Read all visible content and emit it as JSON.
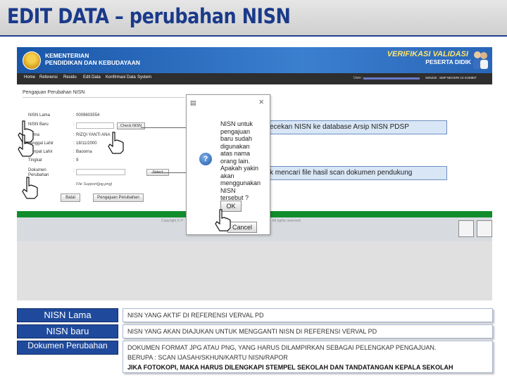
{
  "slide_title": "EDIT DATA – perubahan NISN",
  "app": {
    "ministry_line1": "KEMENTERIAN",
    "ministry_line2": "PENDIDIKAN DAN KEBUDAYAAN",
    "verif_title": "VERIFIKASI VALIDASI",
    "verif_subtitle": "PESERTA DIDIK",
    "nav": {
      "home": "Home",
      "referensi": "Referensi",
      "residu": "Residu",
      "edit_data": "Edit Data",
      "konfirmasi": "Konfirmasi Data",
      "system": "System"
    },
    "user_label": "User :",
    "school": "Sekolah : SMP NEGERI 10 SUMBIT",
    "form_title": "Pengajuan Perubahan NISN",
    "fields": {
      "nisn_lama_label": "NISN Lama",
      "nisn_lama_value": "0009603554",
      "nisn_baru_label": "NISN Baru",
      "check_nisn_btn": "Check NISN",
      "nama_label": "Nama",
      "nama_value": "RIZQI YANTI ANA",
      "tgl_lahir_label": "Tanggal Lahir",
      "tgl_lahir_value": "18/11/2000",
      "tempat_lahir_label": "Tempat Lahir",
      "tempat_lahir_value": "Baoorna",
      "tingkat_label": "Tingkat",
      "tingkat_value": "9",
      "dokumen_label_1": "Dokumen",
      "dokumen_label_2": "Perubahan",
      "select_btn": "Select",
      "file_hint": "File Support(jpg,png)"
    },
    "batal_btn": "Batal",
    "pengajuan_btn": "Pengajuan Perubahan",
    "copyright_left": "Copyright © P",
    "copyright_right": ". All rights reserved."
  },
  "callouts": {
    "check_nisn": "ecekan NISN ke database Arsip NISN PDSP",
    "select_doc": "k mencari file hasil scan dokumen pendukung"
  },
  "dialog": {
    "message": "NISN untuk pengajuan baru sudah digunakan atas nama orang lain. Apakah yakin akan menggunakan NISN tersebut ?",
    "ok": "OK",
    "cancel": "Cancel"
  },
  "rows": [
    {
      "label": "NISN Lama",
      "desc": "NISN YANG AKTIF DI REFERENSI VERVAL PD"
    },
    {
      "label": "NISN baru",
      "desc": "NISN YANG AKAN DIAJUKAN UNTUK MENGGANTI NISN DI REFERENSI VERVAL PD"
    },
    {
      "label": "Dokumen Perubahan",
      "desc1": "DOKUMEN FORMAT JPG ATAU PNG, YANG HARUS DILAMPIRKAN SEBAGAI PELENGKAP PENGAJUAN.",
      "desc2": "BERUPA : SCAN IJASAH/SKHUN/KARTU NISN/RAPOR",
      "desc3": "JIKA FOTOKOPI, MAKA HARUS DILENGKAPI STEMPEL SEKOLAH DAN TANDATANGAN KEPALA SEKOLAH"
    }
  ],
  "colors": {
    "title_blue": "#1a3a8a",
    "header_blue": "#1a56a8",
    "footer_green": "#108c2c",
    "row_label_bg": "#1f4a9c"
  }
}
